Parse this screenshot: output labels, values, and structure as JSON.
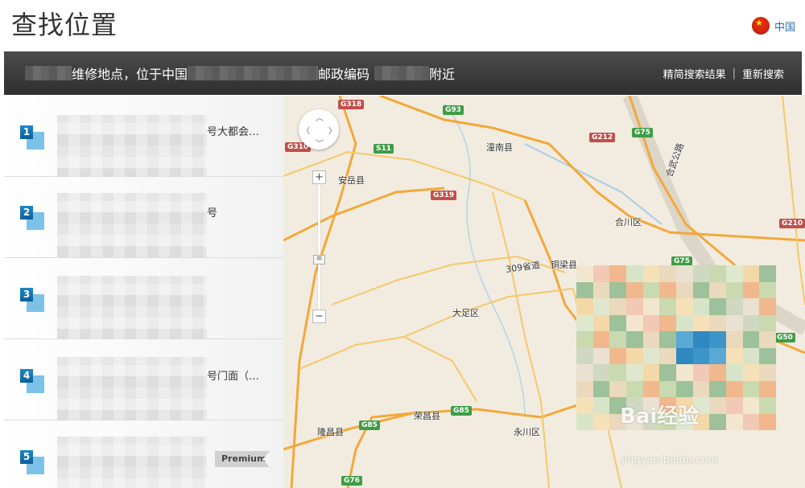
{
  "header": {
    "title": "查找位置",
    "country_label": "中国",
    "flag_icon": "china-flag-icon"
  },
  "result_bar": {
    "text_1": "维修地点，位于中国",
    "text_2": "邮政编码",
    "text_3": "附近",
    "refine_label": "精简搜索结果",
    "separator": "|",
    "new_search_label": "重新搜索"
  },
  "results": [
    {
      "number": "1",
      "text": "号大都会…",
      "premium": ""
    },
    {
      "number": "2",
      "text": "号",
      "premium": ""
    },
    {
      "number": "3",
      "text": "",
      "premium": ""
    },
    {
      "number": "4",
      "text": "号门面（…",
      "premium": ""
    },
    {
      "number": "5",
      "text": "",
      "premium": "Premium"
    }
  ],
  "map": {
    "places": [
      "潼南县",
      "安岳县",
      "合川区",
      "铜梁县",
      "309省道",
      "大足区",
      "隆昌县",
      "荣昌县",
      "永川区",
      "合武公路"
    ],
    "shields": [
      "G318",
      "G93",
      "G75",
      "G212",
      "S11",
      "G319",
      "G310",
      "G85",
      "G85",
      "G76",
      "G75",
      "G210",
      "G50"
    ],
    "zoom_in": "+",
    "zoom_out": "−",
    "zoom_handle": "≡"
  },
  "watermark": {
    "logo": "Bai经验",
    "url": "jingyan.baidu.com"
  },
  "colors": {
    "result_bar": "#3a3a3a",
    "marker": "#1a7fc1",
    "map_bg": "#f1ecdf",
    "highway": "#f3a83b",
    "green_shield": "#3f9c47"
  }
}
